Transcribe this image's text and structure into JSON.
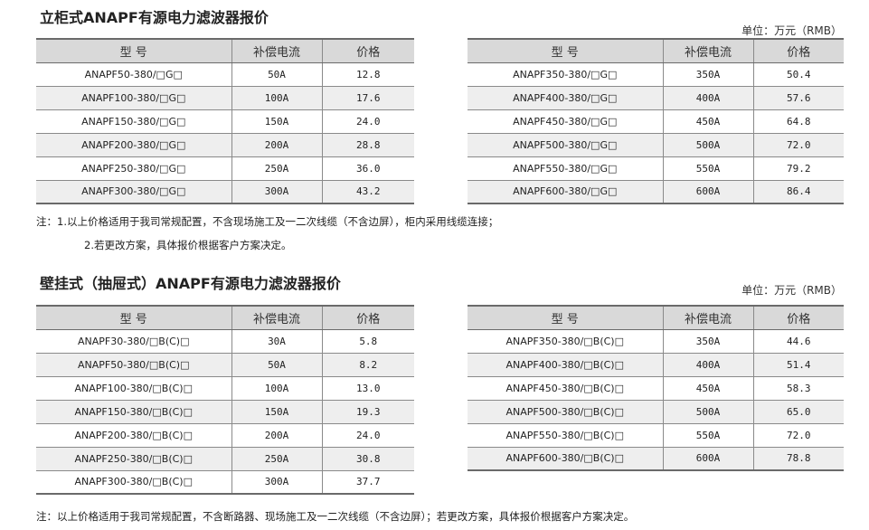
{
  "section1": {
    "title": "立柜式ANAPF有源电力滤波器报价",
    "unit": "单位：万元（RMB）",
    "headers": [
      "型 号",
      "补偿电流",
      "价格"
    ],
    "left_rows": [
      [
        "ANAPF50-380/□G□",
        "50A",
        "12.8"
      ],
      [
        "ANAPF100-380/□G□",
        "100A",
        "17.6"
      ],
      [
        "ANAPF150-380/□G□",
        "150A",
        "24.0"
      ],
      [
        "ANAPF200-380/□G□",
        "200A",
        "28.8"
      ],
      [
        "ANAPF250-380/□G□",
        "250A",
        "36.0"
      ],
      [
        "ANAPF300-380/□G□",
        "300A",
        "43.2"
      ]
    ],
    "right_rows": [
      [
        "ANAPF350-380/□G□",
        "350A",
        "50.4"
      ],
      [
        "ANAPF400-380/□G□",
        "400A",
        "57.6"
      ],
      [
        "ANAPF450-380/□G□",
        "450A",
        "64.8"
      ],
      [
        "ANAPF500-380/□G□",
        "500A",
        "72.0"
      ],
      [
        "ANAPF550-380/□G□",
        "550A",
        "79.2"
      ],
      [
        "ANAPF600-380/□G□",
        "600A",
        "86.4"
      ]
    ],
    "note1": "注：1.以上价格适用于我司常规配置，不含现场施工及一二次线缆（不含边屏），柜内采用线缆连接；",
    "note2": "2.若更改方案，具体报价根据客户方案决定。"
  },
  "section2": {
    "title": "壁挂式（抽屉式）ANAPF有源电力滤波器报价",
    "unit": "单位：万元（RMB）",
    "headers": [
      "型 号",
      "补偿电流",
      "价格"
    ],
    "left_rows": [
      [
        "ANAPF30-380/□B(C)□",
        "30A",
        "5.8"
      ],
      [
        "ANAPF50-380/□B(C)□",
        "50A",
        "8.2"
      ],
      [
        "ANAPF100-380/□B(C)□",
        "100A",
        "13.0"
      ],
      [
        "ANAPF150-380/□B(C)□",
        "150A",
        "19.3"
      ],
      [
        "ANAPF200-380/□B(C)□",
        "200A",
        "24.0"
      ],
      [
        "ANAPF250-380/□B(C)□",
        "250A",
        "30.8"
      ],
      [
        "ANAPF300-380/□B(C)□",
        "300A",
        "37.7"
      ]
    ],
    "right_rows": [
      [
        "ANAPF350-380/□B(C)□",
        "350A",
        "44.6"
      ],
      [
        "ANAPF400-380/□B(C)□",
        "400A",
        "51.4"
      ],
      [
        "ANAPF450-380/□B(C)□",
        "450A",
        "58.3"
      ],
      [
        "ANAPF500-380/□B(C)□",
        "500A",
        "65.0"
      ],
      [
        "ANAPF550-380/□B(C)□",
        "550A",
        "72.0"
      ],
      [
        "ANAPF600-380/□B(C)□",
        "600A",
        "78.8"
      ]
    ],
    "note": "注：以上价格适用于我司常规配置，不含断路器、现场施工及一二次线缆（不含边屏）；若更改方案，具体报价根据客户方案决定。"
  }
}
